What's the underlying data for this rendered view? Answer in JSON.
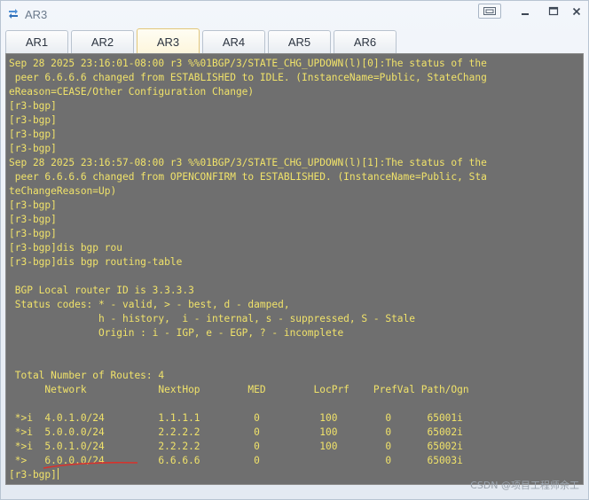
{
  "window": {
    "title": "AR3",
    "icon": "router-app-icon"
  },
  "tabs": [
    {
      "label": "AR1",
      "active": false
    },
    {
      "label": "AR2",
      "active": false
    },
    {
      "label": "AR3",
      "active": true
    },
    {
      "label": "AR4",
      "active": false
    },
    {
      "label": "AR5",
      "active": false
    },
    {
      "label": "AR6",
      "active": false
    }
  ],
  "terminal": {
    "text_color": "#f0e26a",
    "background": "#6f6f6f",
    "lines": [
      "Sep 28 2025 23:16:01-08:00 r3 %%01BGP/3/STATE_CHG_UPDOWN(l)[0]:The status of the",
      " peer 6.6.6.6 changed from ESTABLISHED to IDLE. (InstanceName=Public, StateChang",
      "eReason=CEASE/Other Configuration Change)",
      "[r3-bgp]",
      "[r3-bgp]",
      "[r3-bgp]",
      "[r3-bgp]",
      "Sep 28 2025 23:16:57-08:00 r3 %%01BGP/3/STATE_CHG_UPDOWN(l)[1]:The status of the",
      " peer 6.6.6.6 changed from OPENCONFIRM to ESTABLISHED. (InstanceName=Public, Sta",
      "teChangeReason=Up)",
      "[r3-bgp]",
      "[r3-bgp]",
      "[r3-bgp]",
      "[r3-bgp]dis bgp rou",
      "[r3-bgp]dis bgp routing-table",
      "",
      " BGP Local router ID is 3.3.3.3",
      " Status codes: * - valid, > - best, d - damped,",
      "               h - history,  i - internal, s - suppressed, S - Stale",
      "               Origin : i - IGP, e - EGP, ? - incomplete",
      "",
      "",
      " Total Number of Routes: 4",
      "      Network            NextHop        MED        LocPrf    PrefVal Path/Ogn",
      "",
      " *>i  4.0.1.0/24         1.1.1.1         0          100        0      65001i",
      " *>i  5.0.0.0/24         2.2.2.2         0          100        0      65002i",
      " *>i  5.0.1.0/24         2.2.2.2         0          100        0      65002i",
      " *>   6.0.0.0/24         6.6.6.6         0                     0      65003i",
      "[r3-bgp]"
    ]
  },
  "annotation": {
    "color": "#d9322b"
  },
  "watermark": "CSDN @项目工程师余工"
}
